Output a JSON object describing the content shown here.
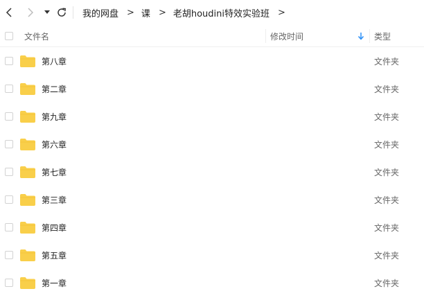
{
  "breadcrumb": [
    "我的网盘",
    "课",
    "老胡houdini特效实验班"
  ],
  "header": {
    "name": "文件名",
    "modified": "修改时间",
    "type": "类型"
  },
  "icons": {
    "back": "chevron-left-icon",
    "forward": "chevron-right-icon",
    "history": "caret-down-icon",
    "refresh": "refresh-icon",
    "sort": "arrow-down-icon",
    "folder": "folder-icon"
  },
  "colors": {
    "folder": "#f9cf4a",
    "sort_arrow": "#2a8ff7",
    "disabled_nav": "#bdbdbd"
  },
  "files": [
    {
      "name": "第八章",
      "modified": "",
      "type": "文件夹"
    },
    {
      "name": "第二章",
      "modified": "",
      "type": "文件夹"
    },
    {
      "name": "第九章",
      "modified": "",
      "type": "文件夹"
    },
    {
      "name": "第六章",
      "modified": "",
      "type": "文件夹"
    },
    {
      "name": "第七章",
      "modified": "",
      "type": "文件夹"
    },
    {
      "name": "第三章",
      "modified": "",
      "type": "文件夹"
    },
    {
      "name": "第四章",
      "modified": "",
      "type": "文件夹"
    },
    {
      "name": "第五章",
      "modified": "",
      "type": "文件夹"
    },
    {
      "name": "第一章",
      "modified": "",
      "type": "文件夹"
    }
  ]
}
